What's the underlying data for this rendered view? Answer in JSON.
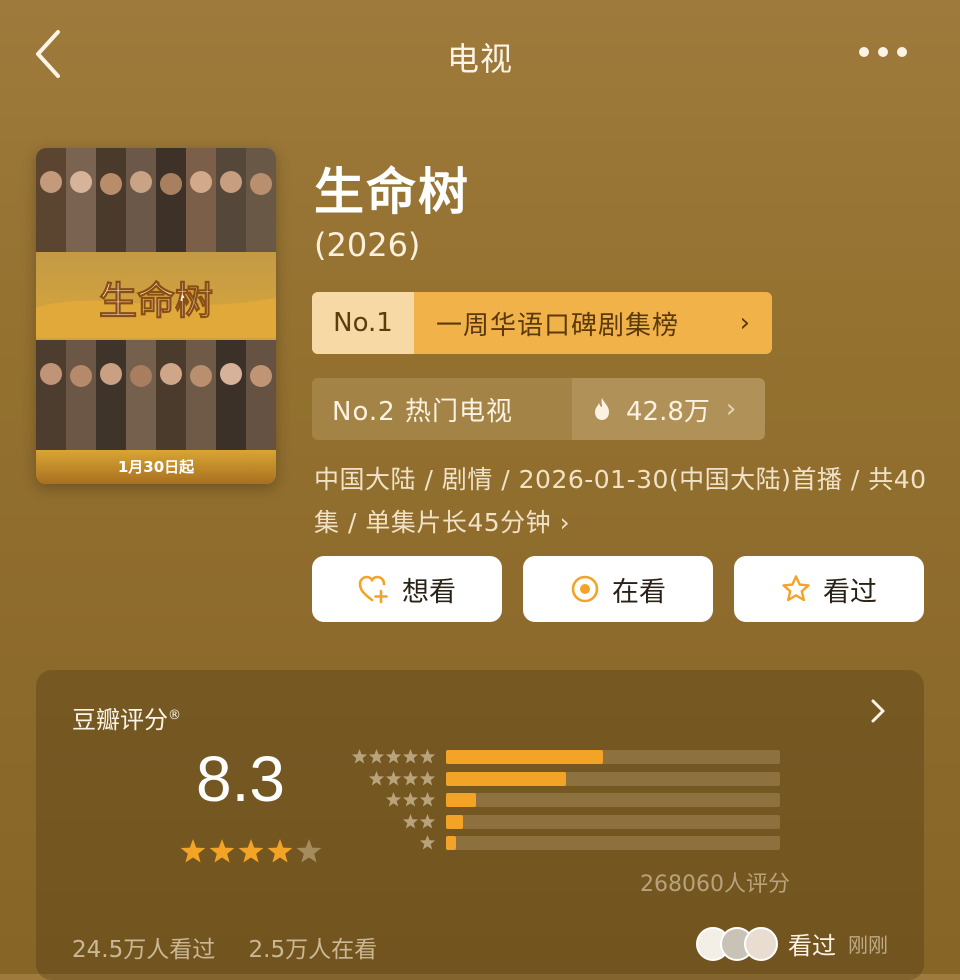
{
  "nav": {
    "title": "电视"
  },
  "movie": {
    "title": "生命树",
    "year": "(2026)",
    "poster_title": "生命树",
    "poster_date": "1月30日起",
    "info": "中国大陆 / 剧情 / 2026-01-30(中国大陆)首播 / 共40集 / 单集片长45分钟",
    "info_more": "›"
  },
  "rank1": {
    "no": "No.1",
    "label": "一周华语口碑剧集榜",
    "chev": "›"
  },
  "rank2": {
    "label": "No.2 热门电视",
    "hot": "42.8万",
    "chev": "›"
  },
  "actions": {
    "want": "想看",
    "watching": "在看",
    "watched": "看过"
  },
  "rating": {
    "title": "豆瓣评分",
    "reg": "®",
    "score": "8.3",
    "stars_filled": 4,
    "distribution": [
      0.47,
      0.36,
      0.09,
      0.05,
      0.03
    ],
    "count": "268060人评分"
  },
  "footer": {
    "seen": "24.5万人看过",
    "watching": "2.5万人在看",
    "status": "看过",
    "time": "刚刚"
  },
  "colors": {
    "accent": "#f3a326",
    "rank_bg": "#f1b24a"
  }
}
